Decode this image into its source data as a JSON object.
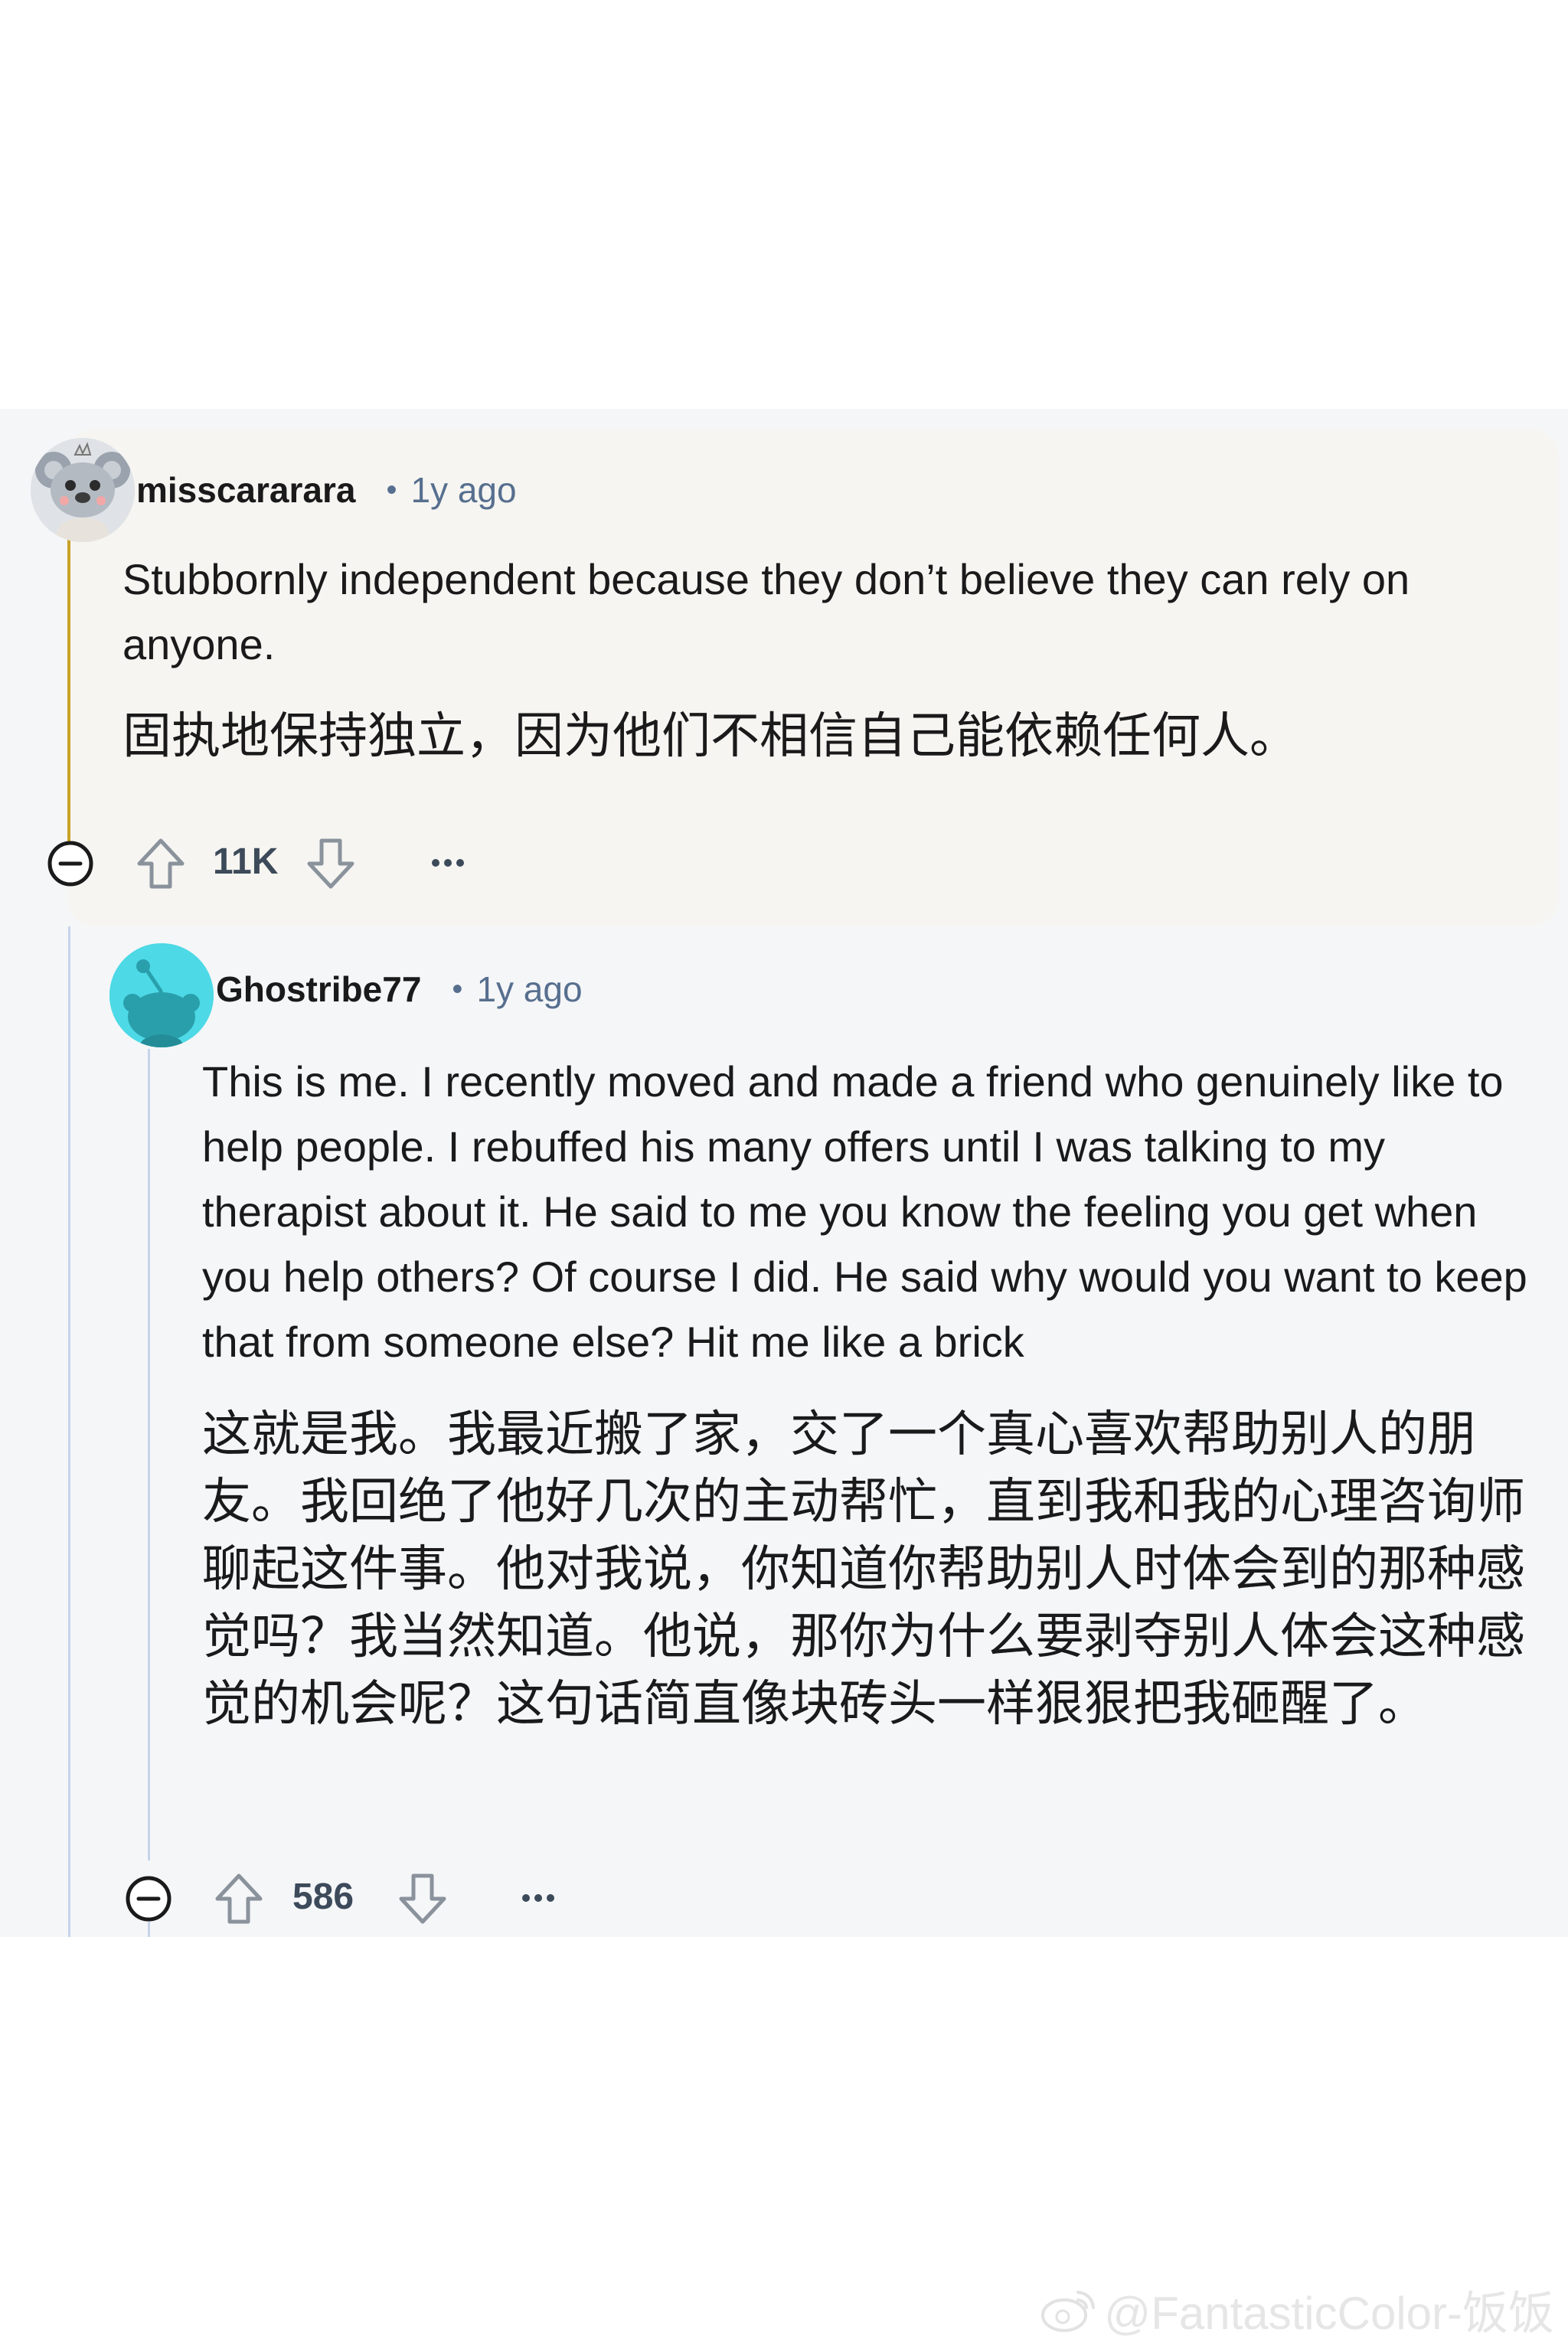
{
  "comments": [
    {
      "author": "misscararara",
      "time": "1y ago",
      "body_en": "Stubbornly independent because they don’t believe they can rely on anyone.",
      "body_zh": "固执地保持独立，因为他们不相信自己能依赖任何人。",
      "score": "11K",
      "avatar_icon": "koala-avatar-icon"
    },
    {
      "author": "Ghostribe77",
      "time": "1y ago",
      "body_en": "This is me. I recently moved and made a friend who genuinely like to help people. I rebuffed his many offers until I was talking to my therapist about it. He said to me you know the feeling you get when you help others? Of course I did. He said why would you want to keep that from someone else? Hit me like a brick",
      "body_zh": "这就是我。我最近搬了家，交了一个真心喜欢帮助别人的朋友。我回绝了他好几次的主动帮忙，直到我和我的心理咨询师聊起这件事。他对我说，你知道你帮助别人时体会到的那种感觉吗？我当然知道。他说，那你为什么要剥夺别人体会这种感觉的机会呢？这句话简直像块砖头一样狠狠把我砸醒了。",
      "score": "586",
      "avatar_icon": "snoo-avatar-icon"
    }
  ],
  "watermark": {
    "icon": "weibo-icon",
    "text": "@FantasticColor-饭饭"
  },
  "colors": {
    "thread_bg": "#f5f6f8",
    "highlight_bg": "#f6f5f1",
    "thread_line_highlight": "#c9a227",
    "thread_line": "#c6d4ea",
    "meta_text": "#576f8f",
    "avatar_teal": "#4dd9e6"
  }
}
